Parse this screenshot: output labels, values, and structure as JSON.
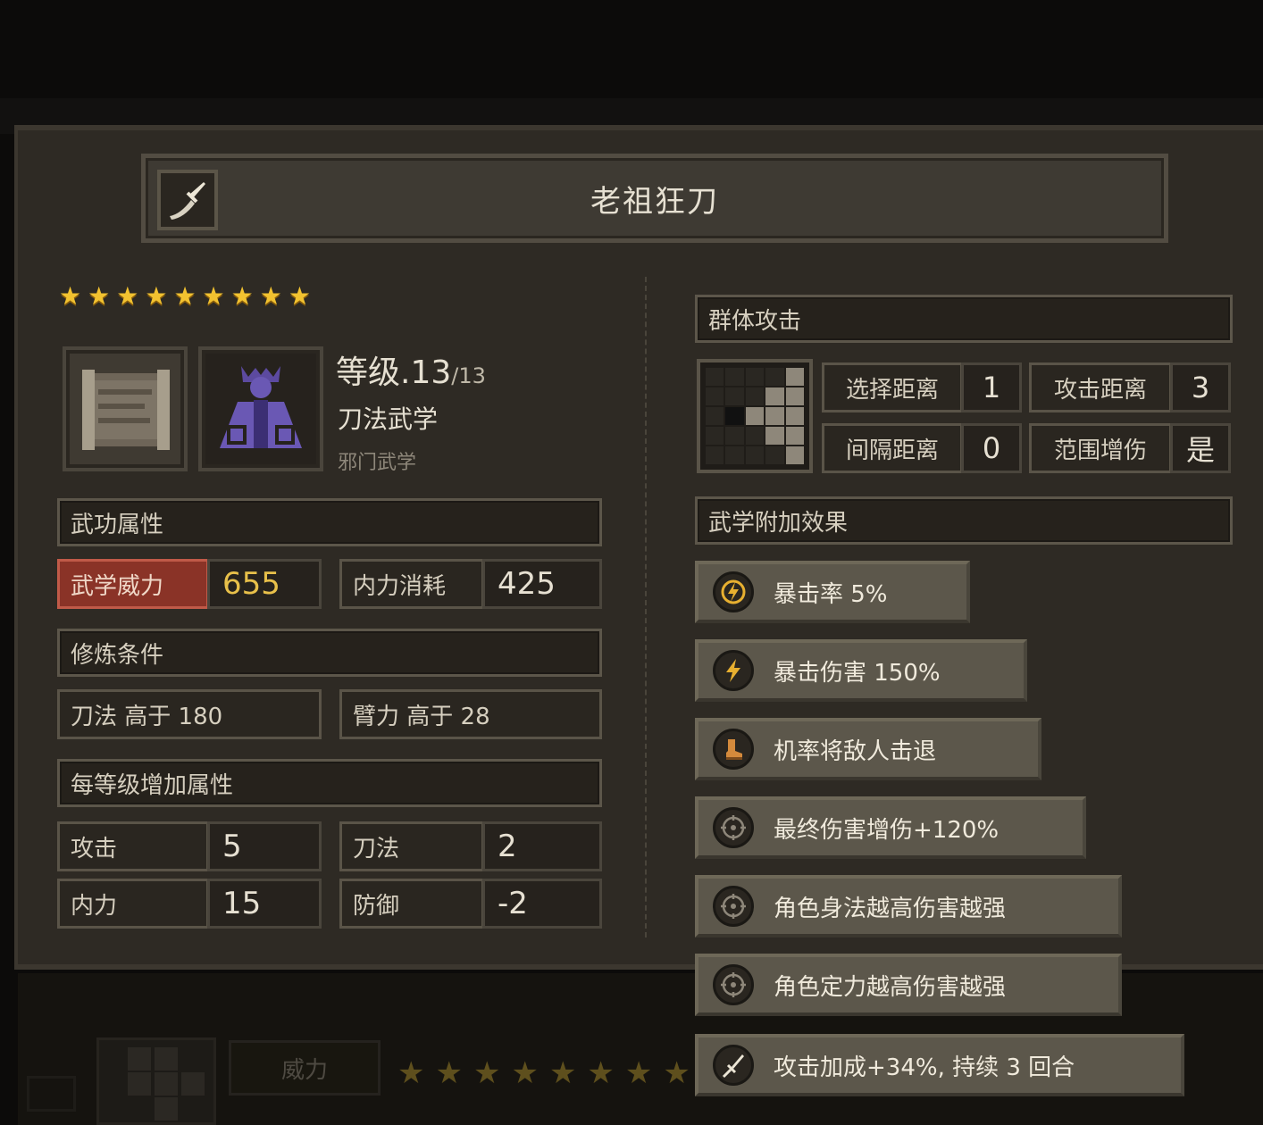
{
  "skill": {
    "title": "老祖狂刀",
    "stars": 9,
    "level_label": "等级.13",
    "level_max": "/13",
    "category": "刀法武学",
    "school": "邪门武学"
  },
  "attributes": {
    "header": "武功属性",
    "power_label": "武学威力",
    "power_value": "655",
    "mp_cost_label": "内力消耗",
    "mp_cost_value": "425"
  },
  "requirements": {
    "header": "修炼条件",
    "items": [
      "刀法 高于 180",
      "臂力 高于 28"
    ]
  },
  "per_level": {
    "header": "每等级增加属性",
    "items": [
      {
        "label": "攻击",
        "value": "5"
      },
      {
        "label": "刀法",
        "value": "2"
      },
      {
        "label": "内力",
        "value": "15"
      },
      {
        "label": "防御",
        "value": "-2"
      }
    ]
  },
  "range": {
    "header": "群体攻击",
    "select_distance_label": "选择距离",
    "select_distance_value": "1",
    "attack_distance_label": "攻击距离",
    "attack_distance_value": "3",
    "interval_distance_label": "间隔距离",
    "interval_distance_value": "0",
    "area_damage_label": "范围增伤",
    "area_damage_value": "是"
  },
  "effects": {
    "header": "武学附加效果",
    "items": [
      {
        "icon": "lightning-circle-icon",
        "text": "暴击率 5%"
      },
      {
        "icon": "lightning-icon",
        "text": "暴击伤害 150%"
      },
      {
        "icon": "boot-icon",
        "text": "机率将敌人击退"
      },
      {
        "icon": "target-icon",
        "text": "最终伤害增伤+120%"
      },
      {
        "icon": "target-icon",
        "text": "角色身法越高伤害越强"
      },
      {
        "icon": "target-icon",
        "text": "角色定力越高伤害越强"
      },
      {
        "icon": "sword-icon",
        "text": "攻击加成+34%, 持续 3 回合"
      }
    ]
  },
  "background": {
    "power_label": "威力",
    "stars": 8
  },
  "colors": {
    "star": "#f2c230",
    "power_highlight": "#8a3327",
    "power_value": "#e8c04a",
    "panel": "#2e2a24",
    "effect_banner": "#5c574b"
  }
}
